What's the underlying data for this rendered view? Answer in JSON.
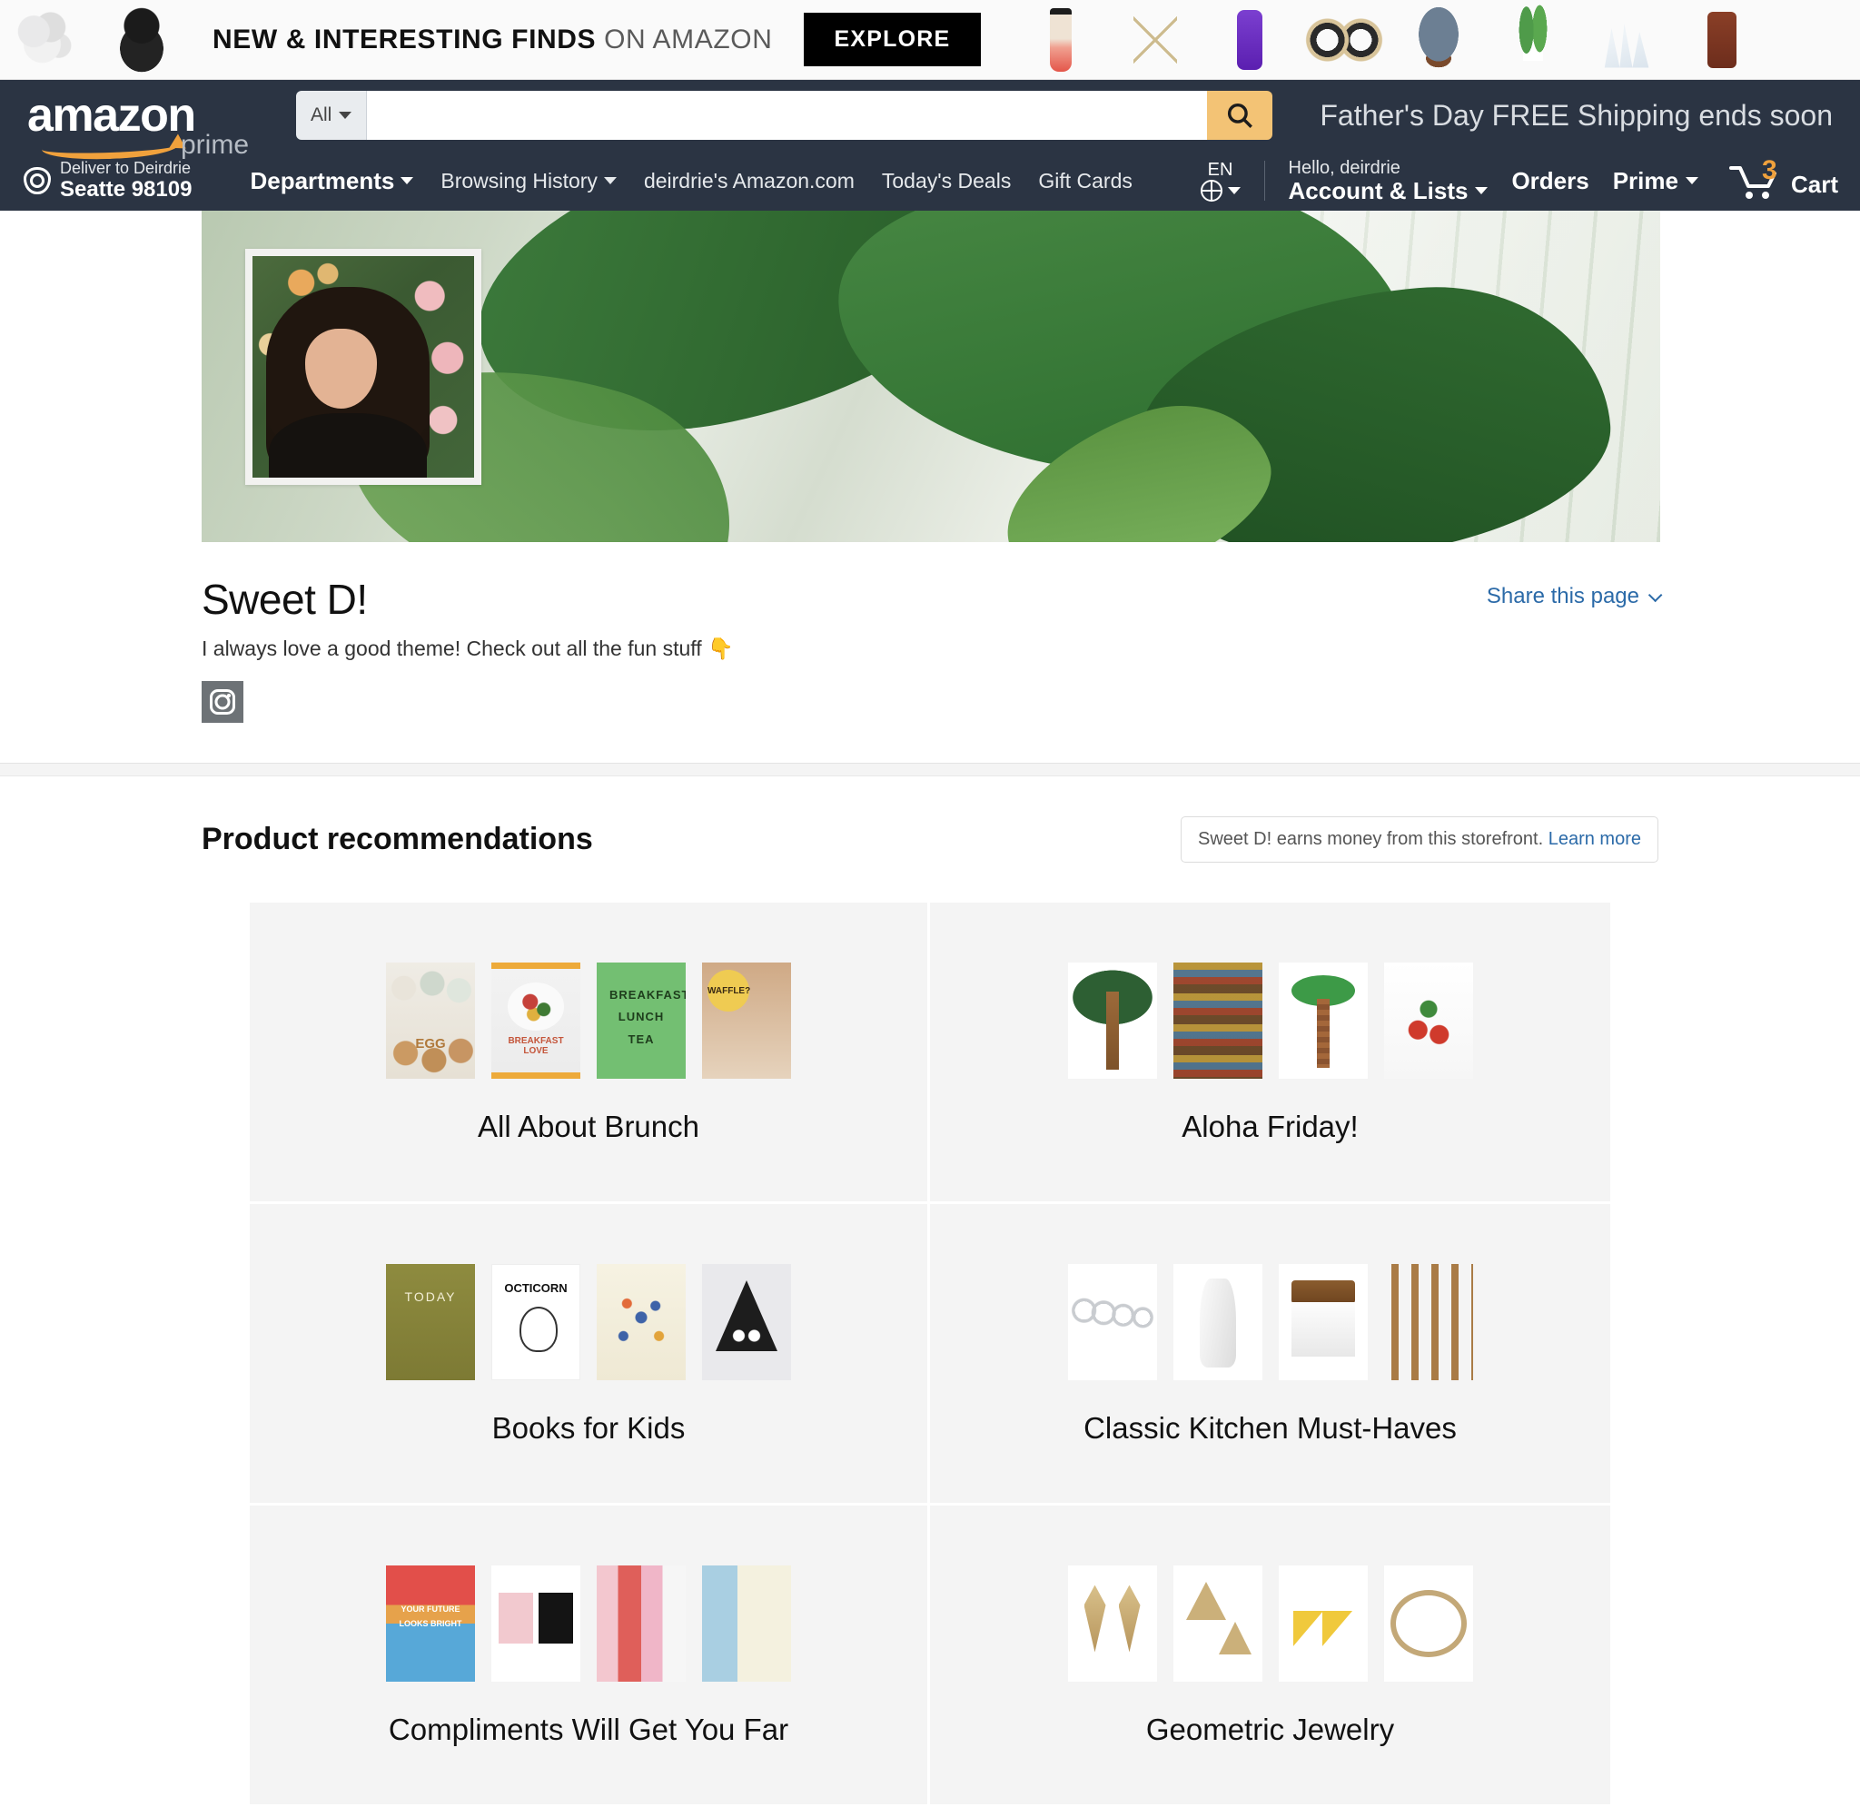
{
  "promo": {
    "headline_bold": "NEW & INTERESTING FINDS",
    "headline_rest": " ON AMAZON",
    "explore_label": "EXPLORE",
    "thumbs": [
      {
        "name": "sheep-figurine-thumb",
        "art": "d-sheep"
      },
      {
        "name": "lucky-cat-thumb",
        "art": "d-cat"
      },
      {
        "name": "travel-tumbler-thumb",
        "art": "d-tumbler"
      },
      {
        "name": "geometric-planter-thumb",
        "art": "d-geo"
      },
      {
        "name": "purple-vase-thumb",
        "art": "d-purple"
      },
      {
        "name": "cuff-earrings-thumb",
        "art": "d-cuff"
      },
      {
        "name": "geode-stone-thumb",
        "art": "d-geode"
      },
      {
        "name": "potted-plant-thumb",
        "art": "d-plant"
      },
      {
        "name": "crystal-cluster-thumb",
        "art": "d-crystal"
      },
      {
        "name": "leather-goods-thumb",
        "art": "d-leather"
      }
    ]
  },
  "nav": {
    "logo_text": "amazon",
    "logo_sub": "prime",
    "search": {
      "category": "All",
      "value": "",
      "placeholder": ""
    },
    "fathers_day_message": "Father's Day FREE Shipping ends soon",
    "deliver": {
      "line1": "Deliver to Deirdrie",
      "line2": "Seatte 98109"
    },
    "links": [
      {
        "label": "Departments",
        "caret": true,
        "bold": true
      },
      {
        "label": "Browsing History",
        "caret": true,
        "bold": false
      },
      {
        "label": "deirdrie's Amazon.com",
        "caret": false,
        "bold": false
      },
      {
        "label": "Today's Deals",
        "caret": false,
        "bold": false
      },
      {
        "label": "Gift Cards",
        "caret": false,
        "bold": false
      }
    ],
    "language": "EN",
    "account": {
      "greeting": "Hello, deirdrie",
      "label": "Account & Lists"
    },
    "orders_label": "Orders",
    "prime_label": "Prime",
    "cart": {
      "count": "3",
      "label": "Cart"
    }
  },
  "storefront": {
    "title": "Sweet D!",
    "tagline": "I always love a good theme! Check out all the fun stuff 👇",
    "social_icon": "instagram-icon",
    "share_label": "Share this page"
  },
  "recommendations": {
    "heading": "Product recommendations",
    "disclosure_text": "Sweet D! earns money from this storefront.",
    "disclosure_link": "Learn more",
    "cards": [
      {
        "label": "All About Brunch",
        "thumbs": [
          "t-egg",
          "t-bl",
          "t-tea",
          "t-waf"
        ]
      },
      {
        "label": "Aloha Friday!",
        "thumbs": [
          "t-palm",
          "t-tiki",
          "t-inflate",
          "t-picks"
        ]
      },
      {
        "label": "Books for Kids",
        "thumbs": [
          "t-today",
          "t-oct",
          "t-wild",
          "t-tri"
        ]
      },
      {
        "label": "Classic Kitchen Must-Haves",
        "thumbs": [
          "t-measure",
          "t-pitcher",
          "t-crock",
          "t-spoons"
        ]
      },
      {
        "label": "Compliments Will Get You Far",
        "thumbs": [
          "t-note",
          "t-cards",
          "t-strips",
          "t-journal"
        ]
      },
      {
        "label": "Geometric Jewelry",
        "thumbs": [
          "t-earr",
          "t-tris",
          "t-yellow",
          "t-bangle"
        ]
      }
    ]
  },
  "colors": {
    "nav_bg": "#2b3443",
    "accent_orange": "#f0a13c",
    "search_button": "#f3c375",
    "link_blue": "#2b6aa8",
    "card_bg": "#f4f4f4"
  }
}
